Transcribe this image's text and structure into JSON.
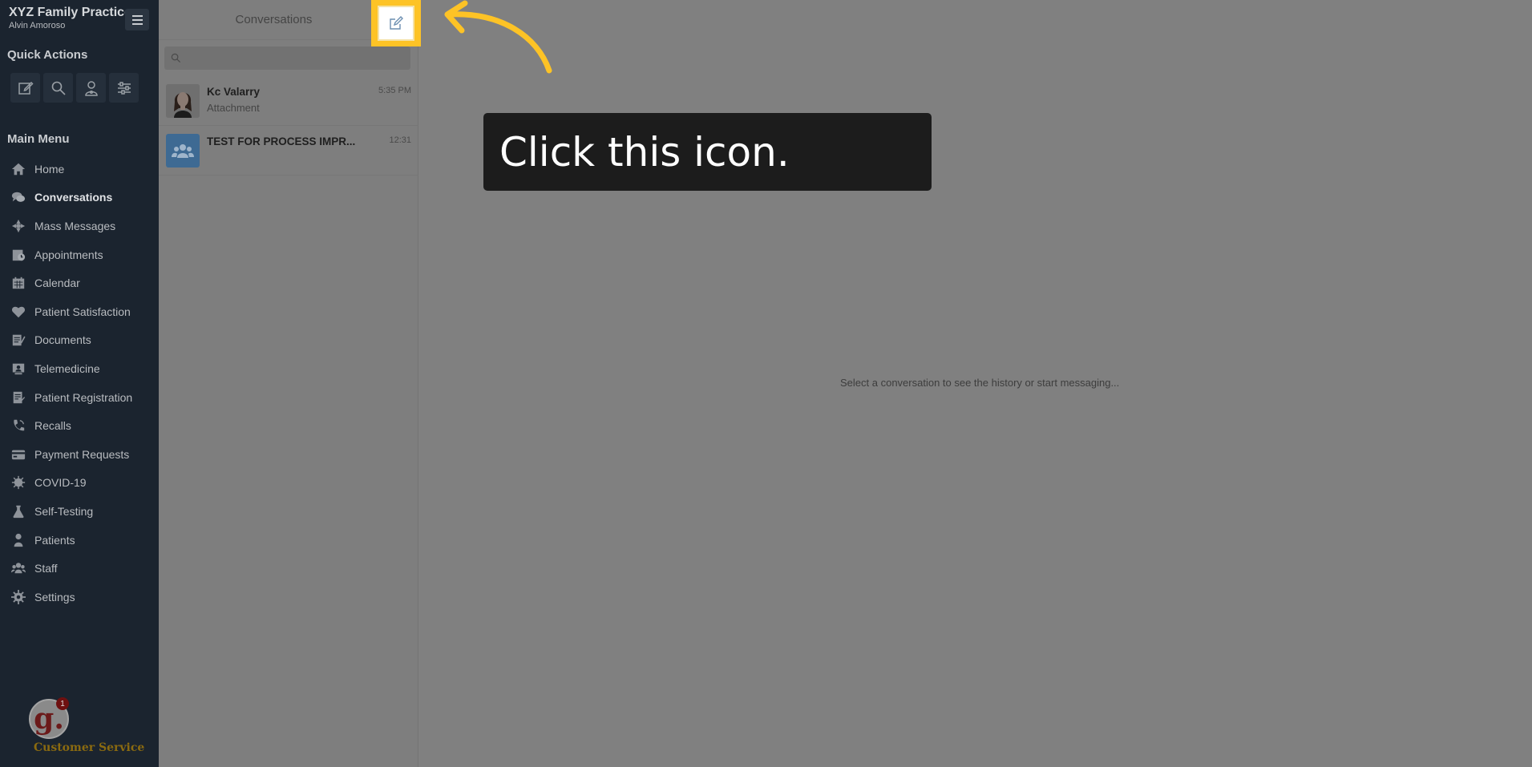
{
  "sidebar": {
    "practice_name": "XYZ Family Practice",
    "user_name": "Alvin Amoroso",
    "quick_actions_title": "Quick Actions",
    "quick_actions": [
      {
        "icon": "compose-icon"
      },
      {
        "icon": "search-icon"
      },
      {
        "icon": "patient-icon"
      },
      {
        "icon": "sliders-icon"
      }
    ],
    "main_menu_title": "Main Menu",
    "items": [
      {
        "label": "Home",
        "icon": "home-icon"
      },
      {
        "label": "Conversations",
        "icon": "chat-icon",
        "active": true
      },
      {
        "label": "Mass Messages",
        "icon": "broadcast-icon"
      },
      {
        "label": "Appointments",
        "icon": "appointments-icon"
      },
      {
        "label": "Calendar",
        "icon": "calendar-icon"
      },
      {
        "label": "Patient Satisfaction",
        "icon": "heart-icon"
      },
      {
        "label": "Documents",
        "icon": "documents-icon"
      },
      {
        "label": "Telemedicine",
        "icon": "telemedicine-icon"
      },
      {
        "label": "Patient Registration",
        "icon": "registration-icon"
      },
      {
        "label": "Recalls",
        "icon": "phone-icon"
      },
      {
        "label": "Payment Requests",
        "icon": "credit-card-icon"
      },
      {
        "label": "COVID-19",
        "icon": "virus-icon"
      },
      {
        "label": "Self-Testing",
        "icon": "flask-icon"
      },
      {
        "label": "Patients",
        "icon": "user-icon"
      },
      {
        "label": "Staff",
        "icon": "users-icon"
      },
      {
        "label": "Settings",
        "icon": "gear-icon"
      }
    ],
    "customer_service": {
      "logo_letter": "g.",
      "badge": "1",
      "label": "Customer Service"
    }
  },
  "conversations": {
    "title": "Conversations",
    "search_placeholder": "",
    "items": [
      {
        "name": "Kc Valarry",
        "subtitle": "Attachment",
        "time": "5:35 PM",
        "avatar": "photo"
      },
      {
        "name": "TEST FOR PROCESS IMPR...",
        "subtitle": "",
        "time": "12:31",
        "avatar": "group"
      }
    ]
  },
  "main": {
    "empty_message": "Select a conversation to see the history or start messaging..."
  },
  "tooltip": {
    "text": "Click this icon."
  },
  "colors": {
    "sidebar_bg": "#1b242f",
    "highlight": "#fdc326",
    "tooltip_bg": "#1c1c1c",
    "overlay": "#808080"
  }
}
